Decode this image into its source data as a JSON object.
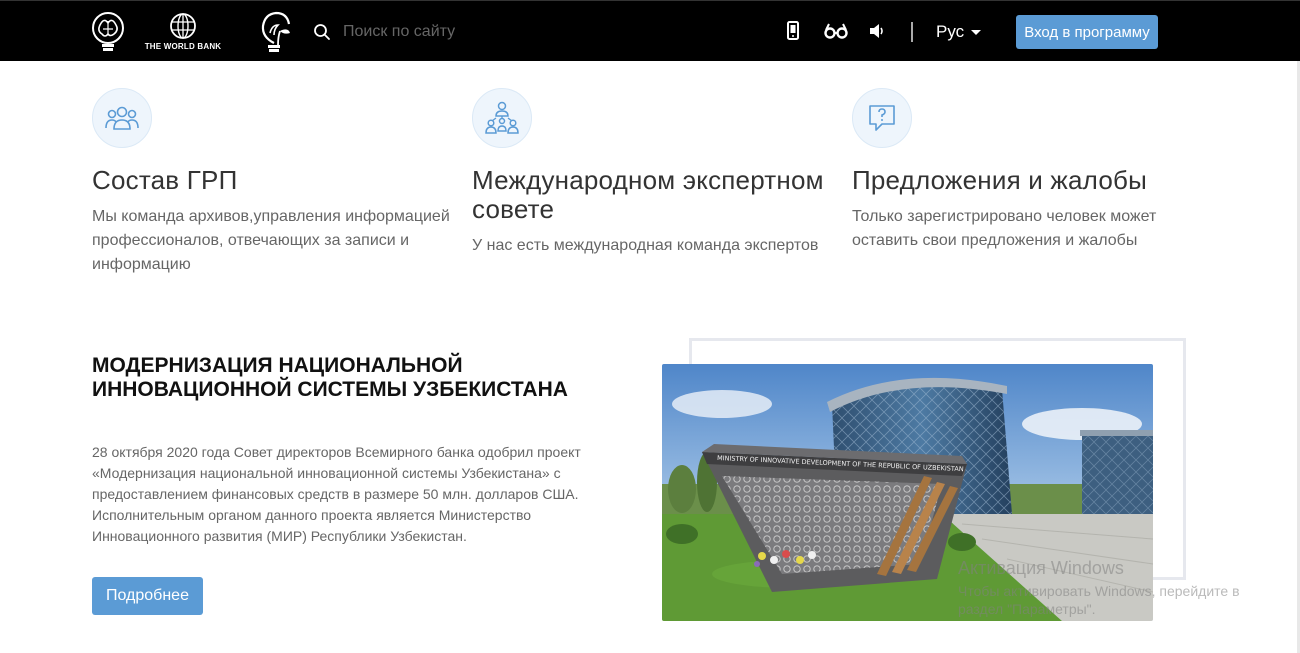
{
  "header": {
    "world_bank_label": "THE WORLD BANK",
    "search_placeholder": "Поиск по сайту",
    "language": "Рус",
    "login_button": "Вход в программу"
  },
  "features": [
    {
      "icon": "team-icon",
      "title": "Состав ГРП",
      "text": "Мы команда архивов,управления информацией профессионалов, отвечающих за записи и информацию"
    },
    {
      "icon": "hierarchy-icon",
      "title": "Международном экспертном совете",
      "text": "У нас есть международная команда экспертов"
    },
    {
      "icon": "question-chat-icon",
      "title": "Предложения и жалобы",
      "text": "Только зарегистрировано человек может оставить свои предложения и жалобы"
    }
  ],
  "project": {
    "title": "Модернизация национальной инновационной системы Узбекистана",
    "description": "28 октября 2020 года Совет директоров Всемирного банка одобрил проект «Модернизация национальной инновационной системы Узбекистана» с предоставлением финансовых средств в размере 50 млн. долларов США. Исполнительным органом данного проекта является Министерство Инновационного развития (МИР) Республики Узбекистан.",
    "more_button": "Подробнее",
    "sign_text": "MINISTRY OF INNOVATIVE DEVELOPMENT OF THE REPUBLIC OF UZBEKISTAN"
  },
  "watermark": {
    "title": "Активация Windows",
    "text": "Чтобы активировать Windows, перейдите в раздел \"Параметры\"."
  },
  "colors": {
    "header_bg": "#000000",
    "accent": "#5b9bd5",
    "icon_bg": "#eef5fc"
  }
}
